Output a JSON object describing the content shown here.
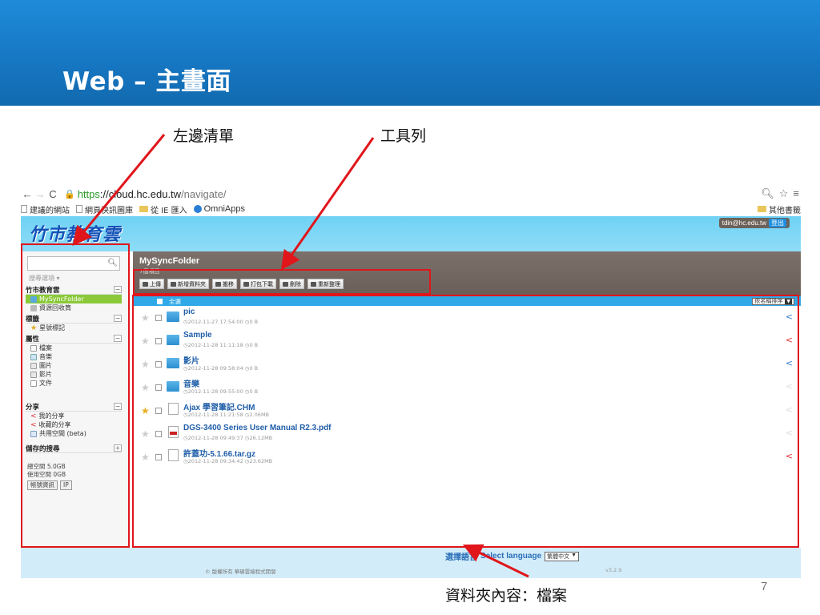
{
  "slide": {
    "title": "Web – 主畫面",
    "page_number": "7",
    "callouts": {
      "sidebar": "左邊清單",
      "toolbar": "工具列",
      "content": "資料夾內容：檔案"
    }
  },
  "browser": {
    "url_scheme": "https",
    "url_host": "://cloud.hc.edu.tw",
    "url_path": "/navigate/",
    "bookmarks": [
      "建議的網站",
      "網頁快訊圖庫",
      "從 IE 匯入",
      "OmniApps"
    ],
    "other_bookmarks": "其他書籤"
  },
  "app": {
    "logo": "竹市教育雲",
    "user_email": "tdin@hc.edu.tw",
    "logout_label": "登出",
    "sidebar": {
      "search_placeholder": "",
      "search_options": "搜尋選項 ▾",
      "sections": [
        {
          "title": "竹市教育雲",
          "toggle": "−",
          "items": [
            "MySyncFolder",
            "資源回收筒"
          ]
        },
        {
          "title": "標籤",
          "toggle": "−",
          "items": [
            "星號標記"
          ]
        },
        {
          "title": "屬性",
          "toggle": "−",
          "items": [
            "檔案",
            "音樂",
            "圖片",
            "影片",
            "文件"
          ]
        },
        {
          "title": "分享",
          "toggle": "−",
          "items": [
            "我的分享",
            "收藏的分享",
            "共用空間 (beta)"
          ]
        },
        {
          "title": "儲存的搜尋",
          "toggle": "+",
          "items": []
        }
      ],
      "total_space": "總空間 5.0GB",
      "used_space": "使用空間 0GB",
      "account_button": "帳號資訊",
      "ip_button": "IP"
    },
    "folder": {
      "title": "MySyncFolder",
      "count": "7個項目"
    },
    "toolbar": [
      "上傳",
      "新增資料夾",
      "搬移",
      "打包下載",
      "刪除",
      "重新整理"
    ],
    "list_header": {
      "select_all": "全選",
      "sort_label": "依名稱排序"
    },
    "files": [
      {
        "name": "pic",
        "date": "2012-11-27 17:54:00",
        "size": "0 B",
        "type": "folder",
        "starred": false,
        "share": "blue"
      },
      {
        "name": "Sample",
        "date": "2012-11-28 11:11:18",
        "size": "0 B",
        "type": "folder",
        "starred": false,
        "share": "red"
      },
      {
        "name": "影片",
        "date": "2012-11-28 09:58:04",
        "size": "0 B",
        "type": "folder",
        "starred": false,
        "share": "blue"
      },
      {
        "name": "音樂",
        "date": "2012-11-28 09:55:00",
        "size": "0 B",
        "type": "folder",
        "starred": false,
        "share": "dim"
      },
      {
        "name": "Ajax 學習筆記.CHM",
        "date": "2012-11-28 11:21:58",
        "size": "2.06MB",
        "type": "file",
        "starred": true,
        "share": "dim"
      },
      {
        "name": "DGS-3400 Series User Manual R2.3.pdf",
        "date": "2012-11-28 09:49:37",
        "size": "26.12MB",
        "type": "pdf",
        "starred": false,
        "share": "dim"
      },
      {
        "name": "許蓋功-5.1.66.tar.gz",
        "date": "2012-11-28 09:34:42",
        "size": "23.62MB",
        "type": "file",
        "starred": false,
        "share": "red"
      }
    ],
    "footer": {
      "select_language_cn": "選擇語言",
      "select_language": "Select language",
      "language_value": "繁體中文",
      "copyright": "© 版權所有 華碩雲端程式開發",
      "version": "v3.2.9"
    }
  }
}
